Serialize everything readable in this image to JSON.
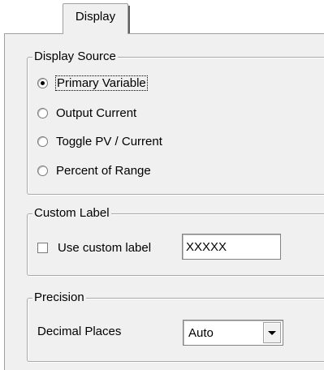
{
  "tab": {
    "label": "Display"
  },
  "display_source": {
    "title": "Display Source",
    "options": [
      {
        "label": "Primary Variable",
        "checked": true
      },
      {
        "label": "Output Current",
        "checked": false
      },
      {
        "label": "Toggle PV / Current",
        "checked": false
      },
      {
        "label": "Percent of Range",
        "checked": false
      }
    ]
  },
  "custom_label": {
    "title": "Custom Label",
    "checkbox_label": "Use custom label",
    "checked": false,
    "value": "XXXXX"
  },
  "precision": {
    "title": "Precision",
    "field_label": "Decimal Places",
    "selected": "Auto"
  }
}
